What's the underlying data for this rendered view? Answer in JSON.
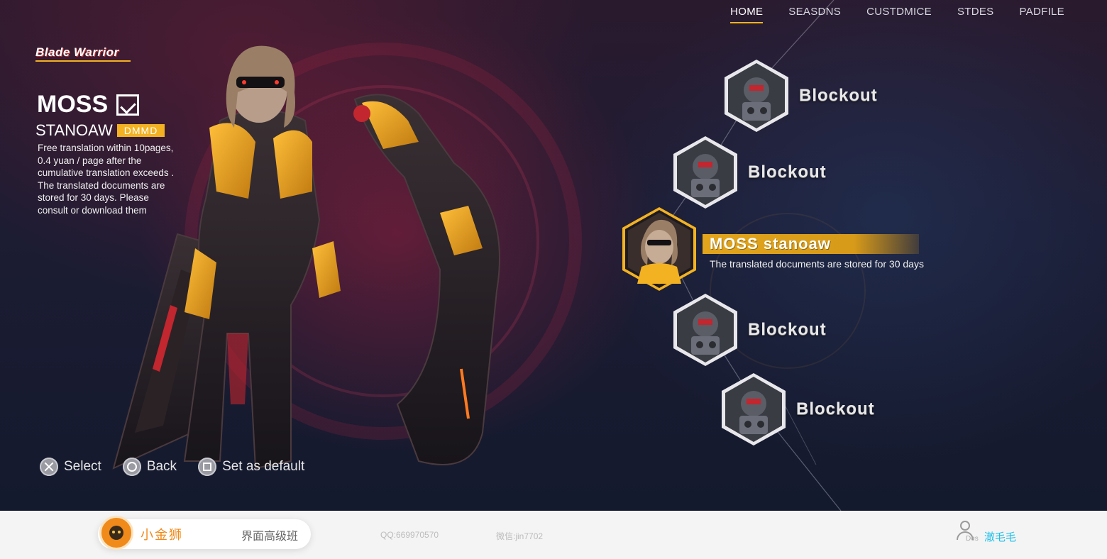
{
  "nav": {
    "items": [
      {
        "label": "HOME",
        "active": true
      },
      {
        "label": "SEASDNS",
        "active": false
      },
      {
        "label": "CUSTDMICE",
        "active": false
      },
      {
        "label": "STDES",
        "active": false
      },
      {
        "label": "PADFILE",
        "active": false
      }
    ]
  },
  "logo": {
    "text": "Blade Warrior"
  },
  "character": {
    "name": "MOSS",
    "subtitle": "STANOAW",
    "badge": "DMMD",
    "description": "Free translation within 10pages, 0.4 yuan / page after the cumulative translation exceeds . The translated documents are stored for 30 days. Please consult or download them"
  },
  "slots": [
    {
      "label": "Blockout"
    },
    {
      "label": "Blockout"
    },
    {
      "label": "MOSS stanoaw",
      "desc": "The translated documents are stored for 30 days"
    },
    {
      "label": "Blockout"
    },
    {
      "label": "Blockout"
    }
  ],
  "controls": {
    "select": "Select",
    "back": "Back",
    "default": "Set as default"
  },
  "footer": {
    "brand": "小金狮",
    "course": "界面高级班",
    "qq": "QQ:669970570",
    "wechat": "微信:jin7702",
    "user_tag": "Des",
    "user_name": "澈毛毛"
  },
  "colors": {
    "accent": "#f3b221",
    "brand": "#f08a1a",
    "user": "#1ec0e8"
  }
}
